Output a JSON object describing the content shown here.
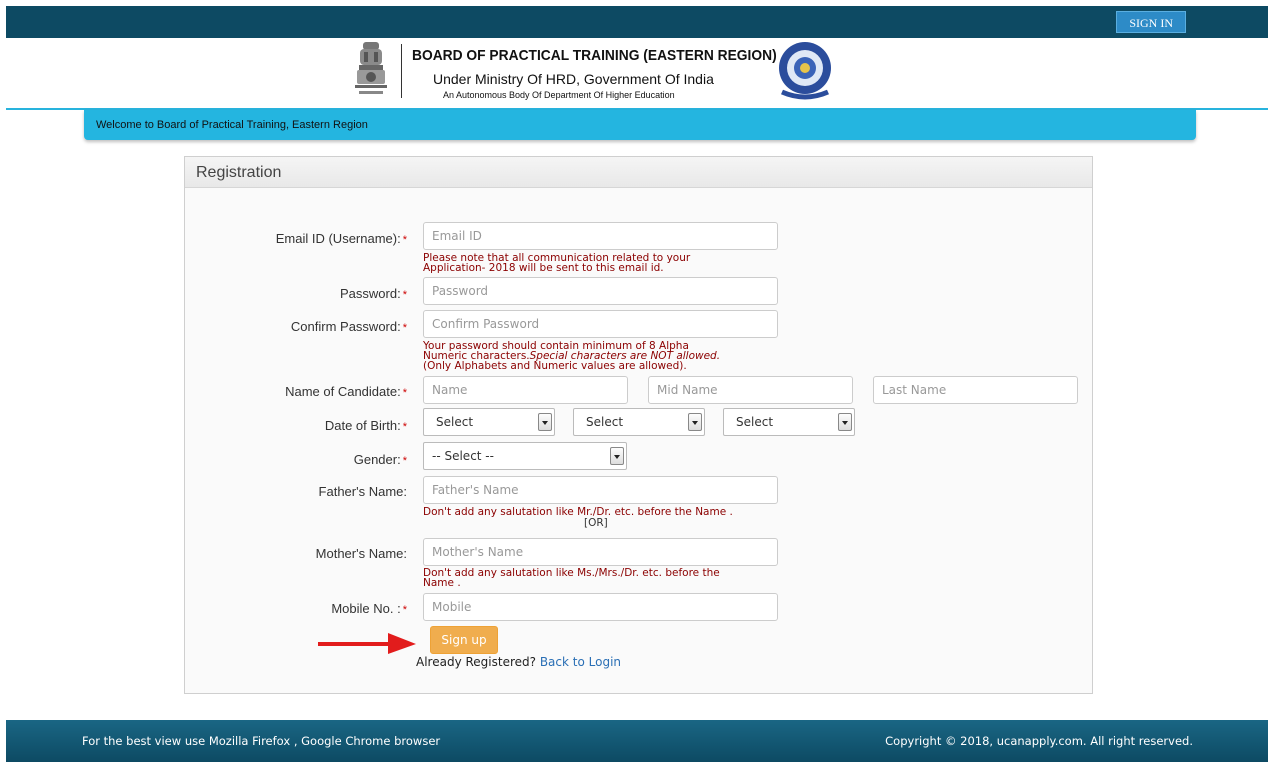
{
  "topbar": {
    "signin_label": "SIGN IN"
  },
  "header": {
    "title": "BOARD OF PRACTICAL TRAINING (EASTERN REGION)",
    "subtitle": "Under Ministry Of HRD, Government Of India",
    "subtitle2": "An Autonomous Body Of Department Of Higher Education",
    "emblem_icon": "national-emblem-icon",
    "logo_icon": "bopt-seal-icon"
  },
  "welcome_text": "Welcome to Board of Practical Training, Eastern Region",
  "form": {
    "heading": "Registration",
    "email": {
      "label": "Email ID (Username):",
      "placeholder": "Email ID",
      "note1": "Please note that all communication related to your",
      "note2": "Application- 2018 will be sent to this email id."
    },
    "password": {
      "label": "Password:",
      "placeholder": "Password"
    },
    "confirm": {
      "label": "Confirm Password:",
      "placeholder": "Confirm Password",
      "note1": "Your password should contain minimum of 8 Alpha",
      "note2a": "Numeric characters.",
      "note2b": "Special characters are NOT allowed.",
      "note3": "(Only Alphabets and Numeric values are allowed)."
    },
    "name": {
      "label": "Name of Candidate:",
      "first": "Name",
      "mid": "Mid Name",
      "last": "Last Name"
    },
    "dob": {
      "label": "Date of Birth:",
      "day": "Select",
      "month": "Select",
      "year": "Select"
    },
    "gender": {
      "label": "Gender:",
      "value": "-- Select --"
    },
    "father": {
      "label": "Father's Name:",
      "placeholder": "Father's Name",
      "note": "Don't add any salutation like Mr./Dr. etc. before the Name .",
      "or": "[OR]"
    },
    "mother": {
      "label": "Mother's Name:",
      "placeholder": "Mother's Name",
      "note1": "Don't add any salutation like Ms./Mrs./Dr. etc. before the",
      "note2": "Name ."
    },
    "mobile": {
      "label": "Mobile No. :",
      "placeholder": "Mobile"
    },
    "required_mark": "*",
    "signup_label": "Sign up",
    "already_text": "Already Registered?",
    "back_link": "Back to Login"
  },
  "footer": {
    "left": "For the best view use Mozilla Firefox , Google Chrome browser",
    "right": "Copyright © 2018, ucanapply.com. All right reserved."
  },
  "colors": {
    "topbar": "#0d4a63",
    "welcome_bar": "#24b5e0",
    "note_text": "#8b0000",
    "signup_button": "#f0ad4e",
    "link": "#2a6fb5"
  }
}
